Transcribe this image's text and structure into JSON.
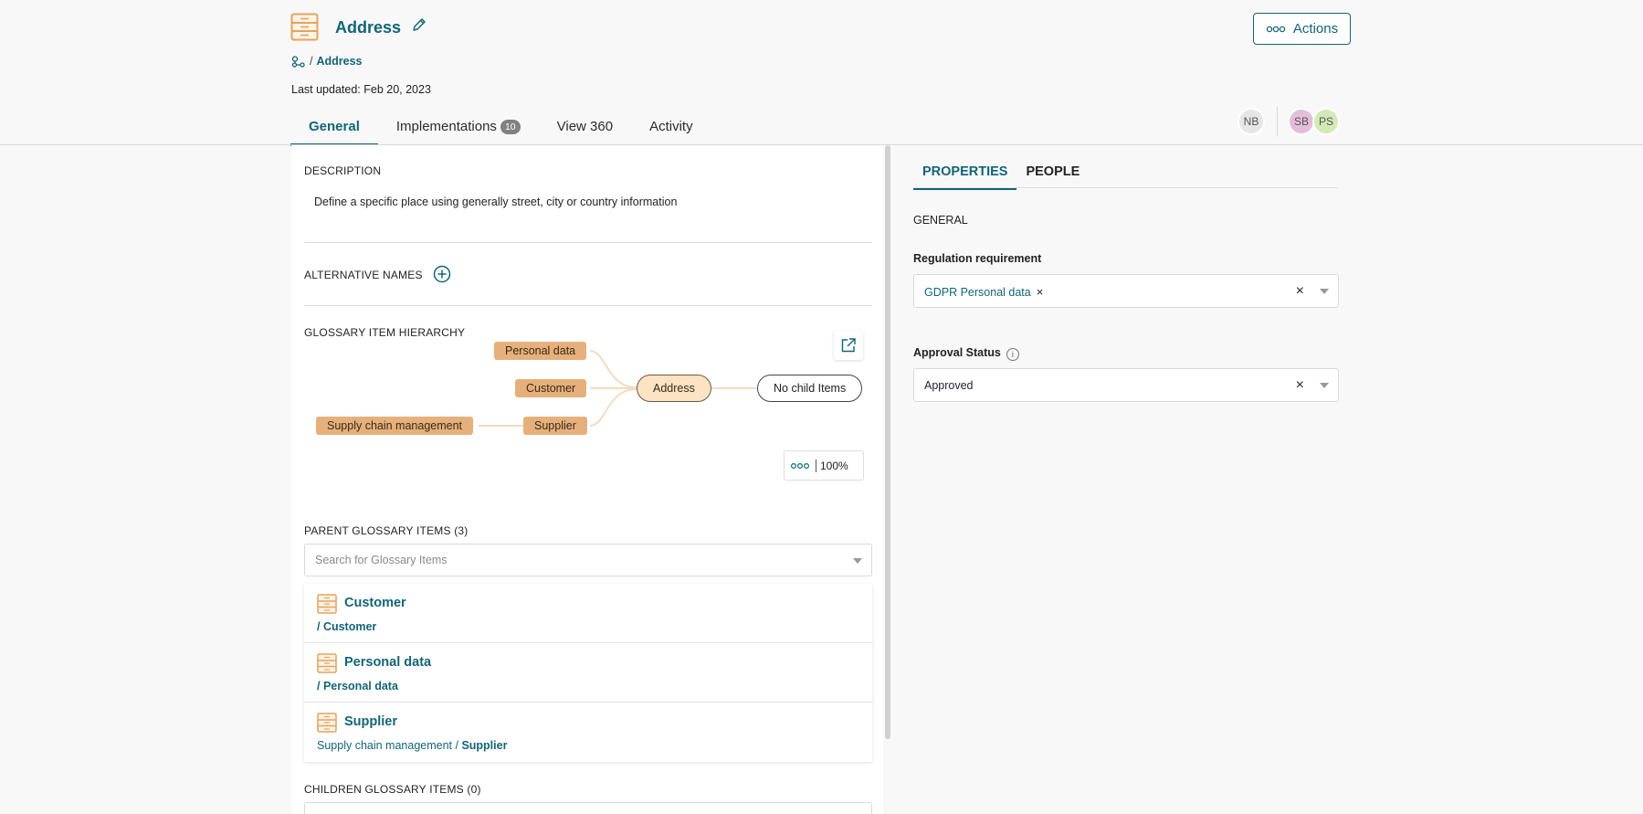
{
  "header": {
    "title": "Address",
    "breadcrumb_current": "Address",
    "last_updated": "Last updated: Feb 20, 2023",
    "actions_label": "Actions"
  },
  "tabs": [
    {
      "label": "General",
      "active": true
    },
    {
      "label": "Implementations",
      "badge": "10"
    },
    {
      "label": "View 360"
    },
    {
      "label": "Activity"
    }
  ],
  "avatars": [
    "NB",
    "SB",
    "PS"
  ],
  "description": {
    "label": "DESCRIPTION",
    "text": "Define a specific place using generally street, city or country information"
  },
  "alternative_names": {
    "label": "ALTERNATIVE NAMES"
  },
  "hierarchy": {
    "label": "GLOSSARY ITEM HIERARCHY",
    "nodes": {
      "personal_data": "Personal data",
      "customer": "Customer",
      "supply_chain": "Supply chain management",
      "supplier": "Supplier",
      "address": "Address",
      "no_child": "No child Items"
    },
    "zoom": "100%"
  },
  "parents": {
    "label": "PARENT GLOSSARY ITEMS (3)",
    "search_placeholder": "Search for Glossary Items",
    "items": [
      {
        "name": "Customer",
        "path_prefix": "",
        "path_last": "/ Customer"
      },
      {
        "name": "Personal data",
        "path_prefix": "",
        "path_last": "/ Personal data"
      },
      {
        "name": "Supplier",
        "path_prefix": "Supply chain management / ",
        "path_last": "Supplier"
      }
    ]
  },
  "children": {
    "label": "CHILDREN GLOSSARY ITEMS (0)"
  },
  "right": {
    "tabs": [
      "PROPERTIES",
      "PEOPLE"
    ],
    "section": "GENERAL",
    "regulation_label": "Regulation requirement",
    "regulation_value": "GDPR Personal data",
    "approval_label": "Approval Status",
    "approval_value": "Approved"
  },
  "colors": {
    "accent": "#136478",
    "node": "#e6b07c",
    "node_selected": "#fbe3c4"
  }
}
